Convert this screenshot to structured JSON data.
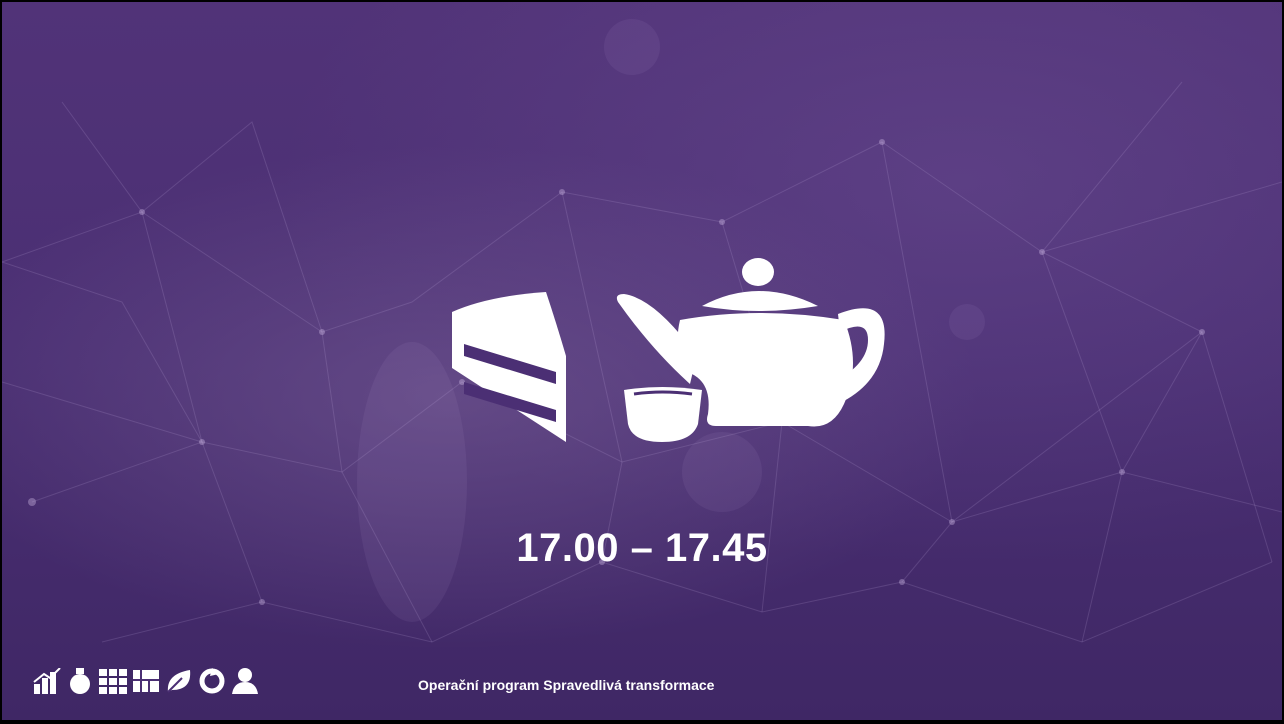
{
  "slide": {
    "time": "17.00 – 17.45",
    "footer_text": "Operační program Spravedlivá transformace"
  },
  "icons": {
    "main": [
      "cake-slice-icon",
      "teapot-icon",
      "tea-cup-icon"
    ],
    "footer": [
      "chart-icon",
      "flask-icon",
      "grid-icon",
      "map-icon",
      "leaf-icon",
      "recycle-icon",
      "person-icon"
    ]
  },
  "colors": {
    "background": "#4b2f74",
    "text": "#ffffff"
  }
}
